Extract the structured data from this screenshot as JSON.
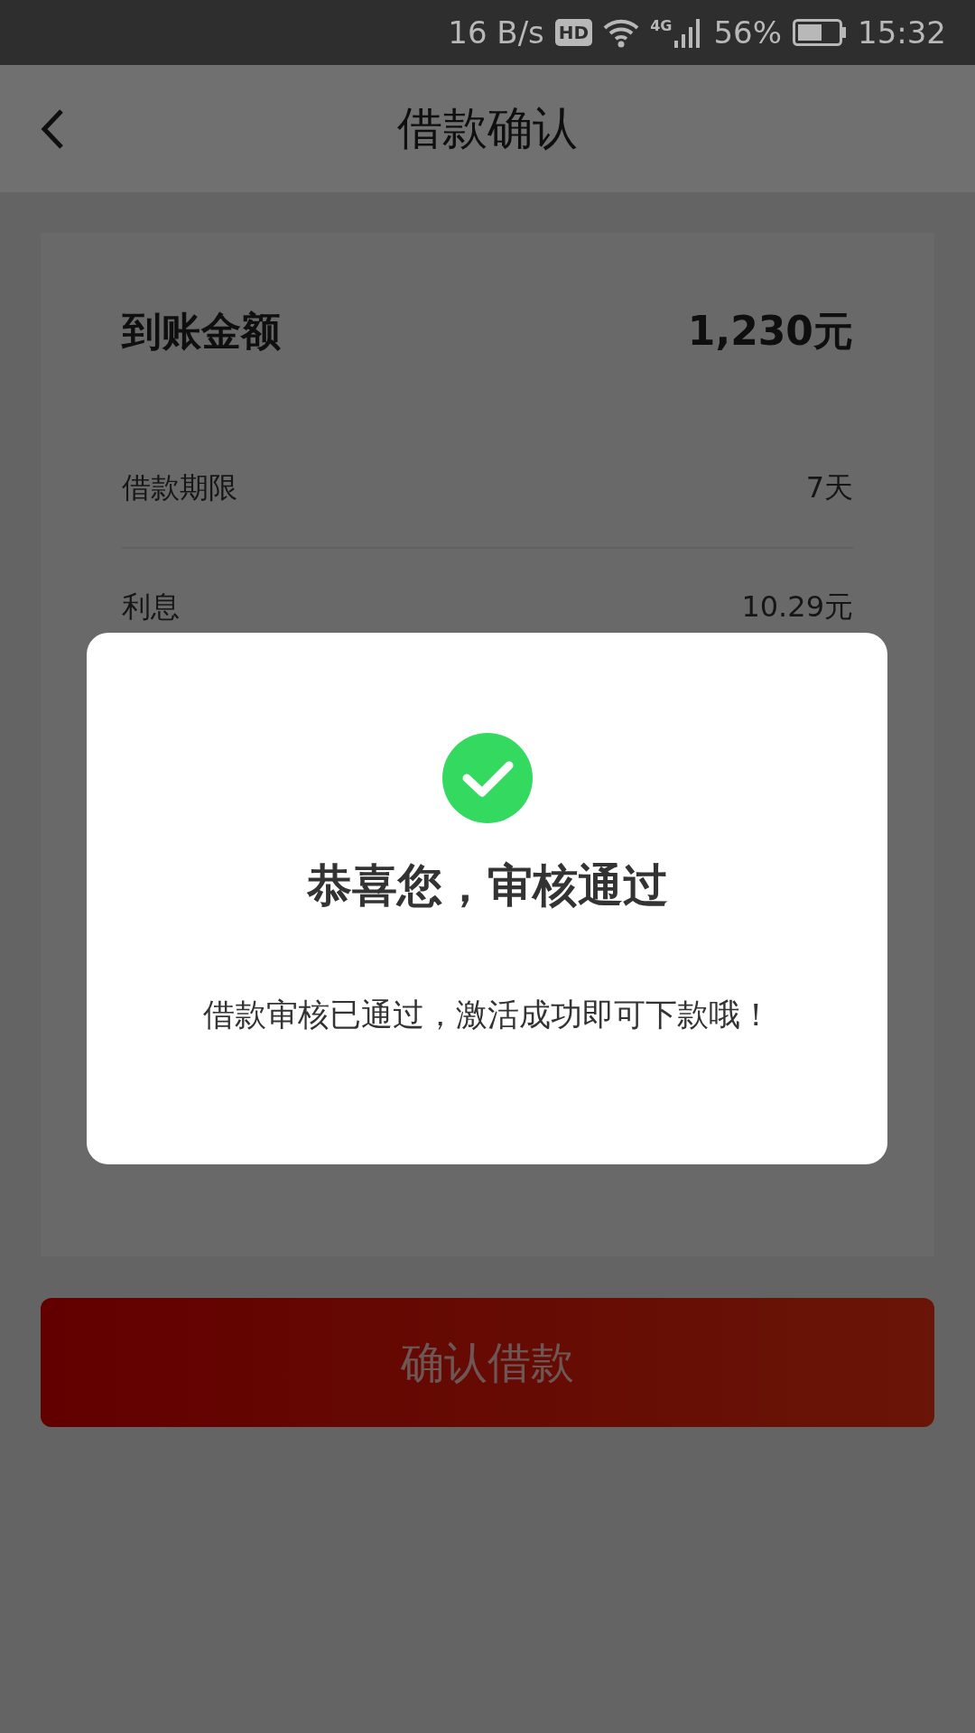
{
  "status_bar": {
    "net_speed": "16 B/s",
    "hd_badge": "HD",
    "network": "4G",
    "battery": "56%",
    "time": "15:32"
  },
  "header": {
    "title": "借款确认"
  },
  "summary": {
    "label": "到账金额",
    "value": "1,230元"
  },
  "details": [
    {
      "label": "借款期限",
      "value": "7天"
    },
    {
      "label": "利息",
      "value": "10.29元"
    }
  ],
  "confirm_button": "确认借款",
  "dialog": {
    "title": "恭喜您，审核通过",
    "message": "借款审核已通过，激活成功即可下款哦！"
  }
}
